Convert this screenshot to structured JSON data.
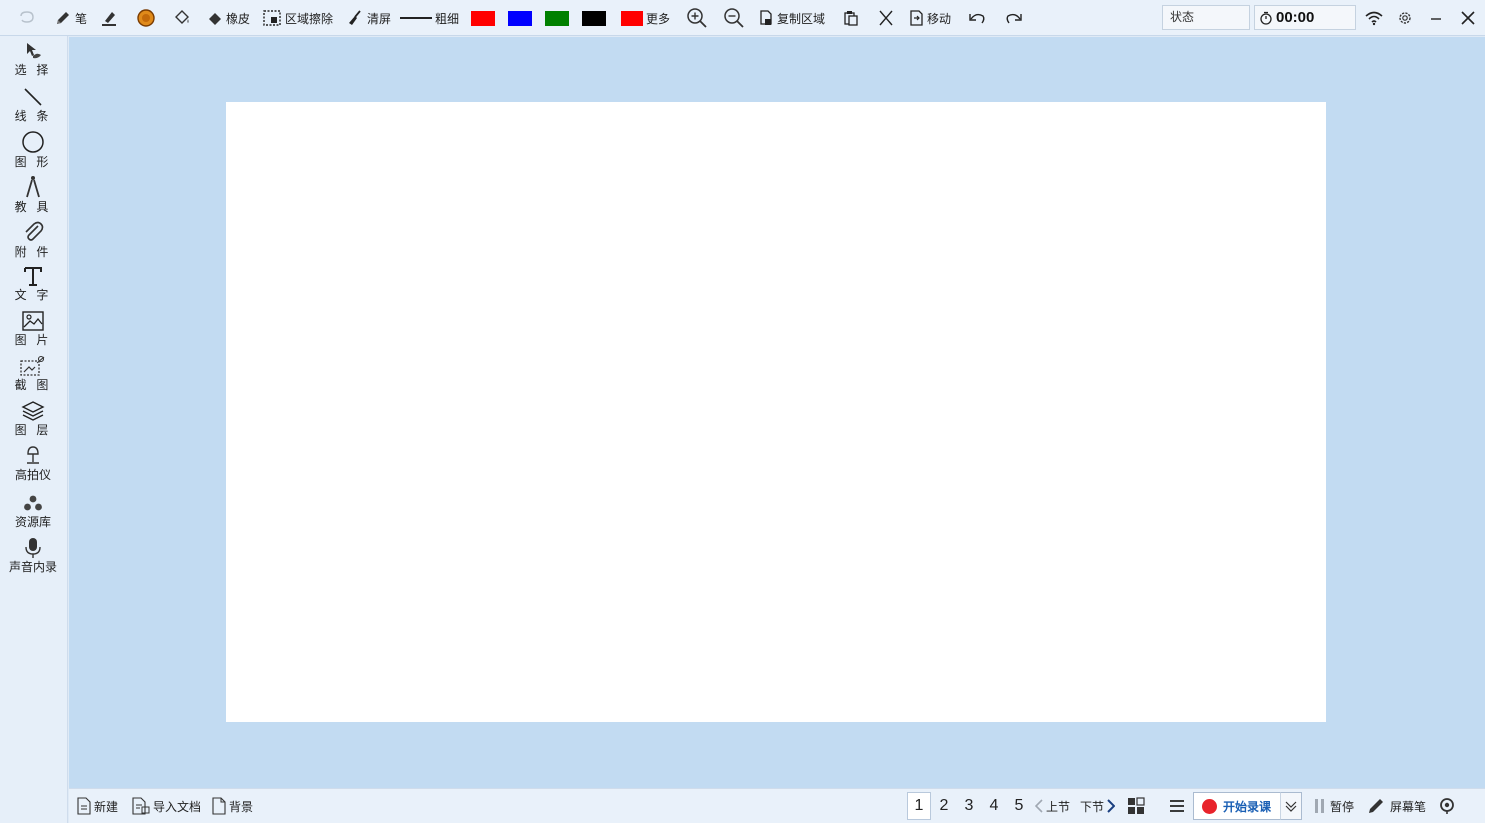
{
  "toolbar": {
    "pen_label": "笔",
    "eraser_label": "橡皮",
    "area_erase_label": "区域擦除",
    "clear_label": "清屏",
    "thickness_label": "粗细",
    "more_label": "更多",
    "copy_area_label": "复制区域",
    "move_label": "移动",
    "swatches": [
      "#ff0000",
      "#0000ff",
      "#008000",
      "#000000"
    ],
    "more_color": "#ff0000",
    "pen_color": "#e08a1a"
  },
  "status": {
    "label": "状态",
    "timer": "00:00"
  },
  "sidebar": {
    "items": [
      {
        "label": "选 择",
        "icon": "select-icon"
      },
      {
        "label": "线 条",
        "icon": "line-icon"
      },
      {
        "label": "图 形",
        "icon": "circle-icon"
      },
      {
        "label": "教 具",
        "icon": "compass-icon"
      },
      {
        "label": "附 件",
        "icon": "paperclip-icon"
      },
      {
        "label": "文 字",
        "icon": "text-icon"
      },
      {
        "label": "图 片",
        "icon": "image-icon"
      },
      {
        "label": "截 图",
        "icon": "screenshot-icon"
      },
      {
        "label": "图 层",
        "icon": "layers-icon"
      },
      {
        "label": "高拍仪",
        "icon": "document-camera-icon"
      },
      {
        "label": "资源库",
        "icon": "resources-icon"
      },
      {
        "label": "声音内录",
        "icon": "microphone-icon"
      }
    ]
  },
  "bottom": {
    "new_label": "新建",
    "import_label": "导入文档",
    "background_label": "背景",
    "pages": [
      "1",
      "2",
      "3",
      "4",
      "5"
    ],
    "active_page": "1",
    "prev_label": "上节",
    "next_label": "下节",
    "record_label": "开始录课",
    "pause_label": "暂停",
    "screen_pen_label": "屏幕笔"
  }
}
